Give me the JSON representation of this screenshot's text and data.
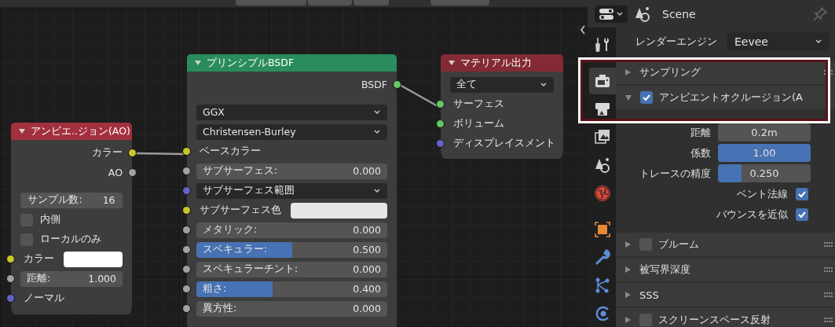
{
  "node_editor": {
    "nodes": [
      {
        "title": "アンビエ..ジョン(AO)",
        "color": "#a3303f",
        "rows": [
          {
            "kind": "output",
            "label": "カラー",
            "color": "#c7c729"
          },
          {
            "kind": "output",
            "label": "AO",
            "color": "#a1a1a1"
          },
          {
            "kind": "value",
            "label": "サンプル数:",
            "value": "16"
          },
          {
            "kind": "checkbox",
            "label": "内側",
            "checked": false
          },
          {
            "kind": "checkbox",
            "label": "ローカルのみ",
            "checked": false
          },
          {
            "kind": "color_input",
            "label": "カラー",
            "color": "#c7c729"
          },
          {
            "kind": "value",
            "label": "距離:",
            "value": "1.000",
            "color": "#a1a1a1"
          },
          {
            "kind": "input",
            "label": "ノーマル",
            "color": "#6363c7"
          }
        ]
      },
      {
        "title": "プリンシプルBSDF",
        "color": "#2a8c5c",
        "rows": [
          {
            "kind": "output",
            "label": "BSDF",
            "color": "#63c763"
          },
          {
            "kind": "dropdown",
            "value": "GGX"
          },
          {
            "kind": "dropdown",
            "value": "Christensen-Burley"
          },
          {
            "kind": "input",
            "label": "ベースカラー",
            "color": "#c7c729"
          },
          {
            "kind": "value",
            "label": "サブサーフェス:",
            "value": "0.000",
            "color": "#a1a1a1"
          },
          {
            "kind": "dropdown",
            "value": "サブサーフェス範囲",
            "color": "#6363c7"
          },
          {
            "kind": "color_input",
            "label": "サブサーフェス色",
            "color": "#c7c729"
          },
          {
            "kind": "value",
            "label": "メタリック:",
            "value": "0.000",
            "color": "#a1a1a1"
          },
          {
            "kind": "slider",
            "label": "スペキュラー:",
            "value": "0.500",
            "level": 0.5,
            "color": "#a1a1a1"
          },
          {
            "kind": "value",
            "label": "スペキュラーチント:",
            "value": "0.000",
            "color": "#a1a1a1"
          },
          {
            "kind": "slider",
            "label": "粗さ:",
            "value": "0.400",
            "level": 0.4,
            "color": "#a1a1a1"
          },
          {
            "kind": "value",
            "label": "異方性:",
            "value": "0.000",
            "color": "#a1a1a1"
          }
        ]
      },
      {
        "title": "マテリアル出力",
        "color": "#832a34",
        "rows": [
          {
            "kind": "dropdown",
            "value": "全て"
          },
          {
            "kind": "input",
            "label": "サーフェス",
            "color": "#63c763"
          },
          {
            "kind": "input",
            "label": "ボリューム",
            "color": "#63c763"
          },
          {
            "kind": "input",
            "label": "ディスプレイスメント",
            "color": "#6363c7"
          }
        ]
      }
    ]
  },
  "properties": {
    "scene": "Scene",
    "tabs": [
      {
        "selected": false
      },
      {
        "selected": true
      },
      {
        "selected": false
      },
      {
        "selected": false
      },
      {
        "selected": false
      },
      {
        "selected": false
      },
      {
        "selected": false
      },
      {
        "selected": false
      },
      {
        "selected": false
      },
      {
        "selected": false
      }
    ],
    "render_engine": {
      "label": "レンダーエンジン",
      "value": "Eevee"
    },
    "panels": [
      {
        "title": "サンプリング",
        "expanded": false
      },
      {
        "title": "アンビエントオクルージョン(A",
        "expanded": true,
        "checked": true,
        "fields": [
          {
            "kind": "number",
            "label": "距離",
            "value": "0.2m"
          },
          {
            "kind": "slider",
            "label": "係数",
            "value": "1.00",
            "level": 1
          },
          {
            "kind": "slider",
            "label": "トレースの精度",
            "value": "0.250",
            "level": 0.25
          },
          {
            "kind": "checkbox",
            "label": "ベント法線",
            "checked": true
          },
          {
            "kind": "checkbox",
            "label": "バウンスを近似",
            "checked": true
          }
        ]
      },
      {
        "title": "ブルーム",
        "expanded": false,
        "checked": false
      },
      {
        "title": "被写界深度",
        "expanded": false
      },
      {
        "title": "SSS",
        "expanded": false
      },
      {
        "title": "スクリーンスペース反射",
        "expanded": false,
        "checked": false
      }
    ]
  }
}
